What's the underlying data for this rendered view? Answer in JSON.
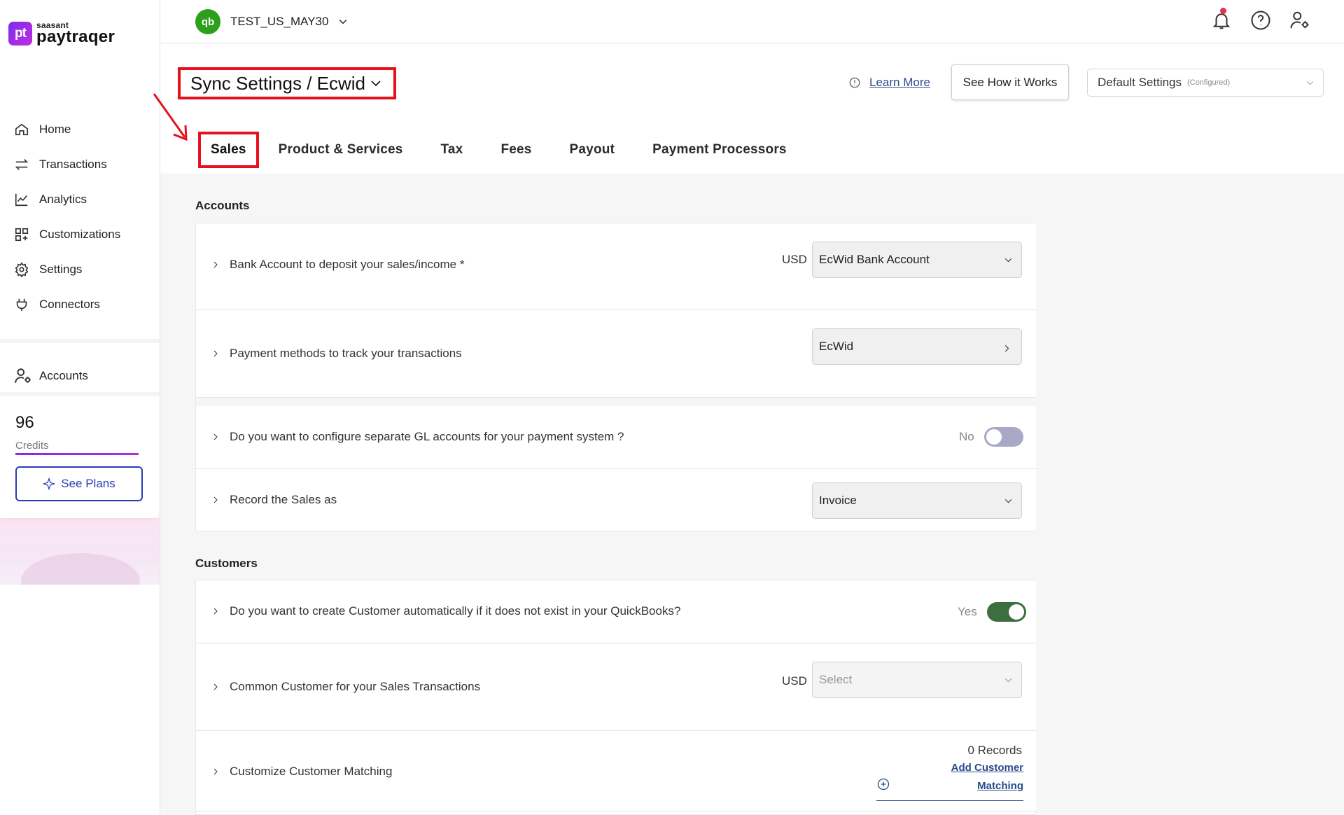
{
  "brand": {
    "logo_mark": "pt",
    "logo_sub": "saasant",
    "logo_main": "paytraqer"
  },
  "sidebar": {
    "items": [
      {
        "label": "Home",
        "icon": "home-icon"
      },
      {
        "label": "Transactions",
        "icon": "transfer-icon"
      },
      {
        "label": "Analytics",
        "icon": "chart-line-icon"
      },
      {
        "label": "Customizations",
        "icon": "grid-plus-icon"
      },
      {
        "label": "Settings",
        "icon": "gear-icon"
      },
      {
        "label": "Connectors",
        "icon": "plug-icon"
      }
    ],
    "accounts_label": "Accounts",
    "credits_value": "96",
    "credits_label": "Credits",
    "see_plans_label": "See Plans"
  },
  "topbar": {
    "qb_logo": "qb",
    "company_name": "TEST_US_MAY30"
  },
  "header": {
    "title": "Sync Settings / Ecwid",
    "learn_more": "Learn More",
    "see_how": "See How it Works",
    "settings_select": "Default Settings",
    "settings_select_note": "(Configured)"
  },
  "tabs": [
    "Sales",
    "Product & Services",
    "Tax",
    "Fees",
    "Payout",
    "Payment Processors"
  ],
  "accounts_section": {
    "title": "Accounts",
    "bank_label": "Bank Account to deposit your sales/income *",
    "bank_currency": "USD",
    "bank_value": "EcWid Bank Account",
    "payment_label": "Payment methods to track your transactions",
    "payment_value": "EcWid",
    "gl_label": "Do you want to configure separate GL accounts for your payment system ?",
    "gl_toggle_text": "No",
    "record_label": "Record the Sales as",
    "record_value": "Invoice"
  },
  "customers_section": {
    "title": "Customers",
    "auto_create_label": "Do you want to create Customer automatically if it does not exist in your QuickBooks?",
    "auto_create_toggle_text": "Yes",
    "common_label": "Common Customer for your Sales Transactions",
    "common_currency": "USD",
    "common_placeholder": "Select",
    "matching_label": "Customize Customer Matching",
    "records_text": "0 Records",
    "add_matching": "Add Customer Matching"
  },
  "colors": {
    "accent": "#2a3db8",
    "highlight": "#e8101c",
    "toggle_on": "#3c6e3e",
    "toggle_off": "#a9a9c7",
    "brand": "#7b2cf0"
  }
}
